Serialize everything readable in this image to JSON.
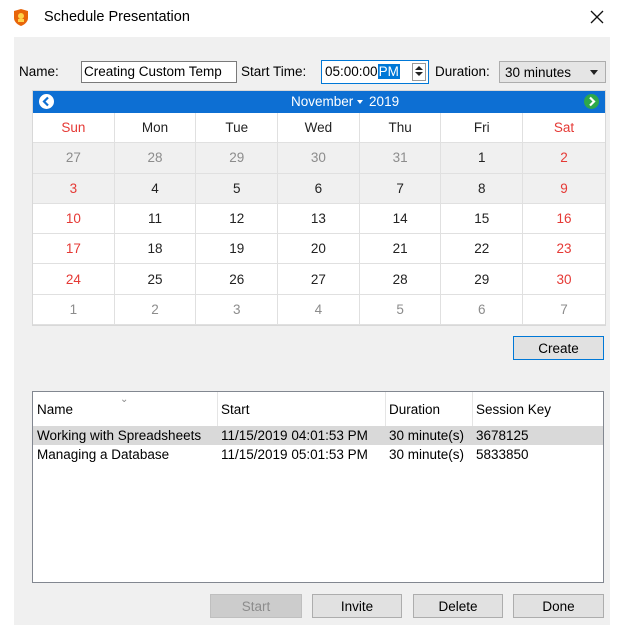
{
  "window": {
    "title": "Schedule Presentation",
    "app_icon": "presentation-app-icon",
    "close_icon": "close-icon"
  },
  "form": {
    "name_label": "Name:",
    "name_value": "Creating Custom Temp",
    "start_time_label": "Start Time:",
    "start_time_value": "05:00:00",
    "start_time_ampm": "PM",
    "duration_label": "Duration:",
    "duration_value": "30 minutes"
  },
  "calendar": {
    "month": "November",
    "year": "2019",
    "weekdays": [
      "Sun",
      "Mon",
      "Tue",
      "Wed",
      "Thu",
      "Fri",
      "Sat"
    ],
    "weeks": [
      [
        "27",
        "28",
        "29",
        "30",
        "31",
        "1",
        "2"
      ],
      [
        "3",
        "4",
        "5",
        "6",
        "7",
        "8",
        "9"
      ],
      [
        "10",
        "11",
        "12",
        "13",
        "14",
        "15",
        "16"
      ],
      [
        "17",
        "18",
        "19",
        "20",
        "21",
        "22",
        "23"
      ],
      [
        "24",
        "25",
        "26",
        "27",
        "28",
        "29",
        "30"
      ],
      [
        "1",
        "2",
        "3",
        "4",
        "5",
        "6",
        "7"
      ]
    ],
    "colors": {
      "header": "#0d6fd3",
      "weekend": "#e53935",
      "other_month": "#8c8c8c"
    }
  },
  "buttons": {
    "create": "Create",
    "start": "Start",
    "invite": "Invite",
    "delete": "Delete",
    "done": "Done"
  },
  "sessions": {
    "columns": [
      "Name",
      "Start",
      "Duration",
      "Session Key"
    ],
    "rows": [
      [
        "Working with Spreadsheets",
        "11/15/2019 04:01:53 PM",
        "30 minute(s)",
        "3678125"
      ],
      [
        "Managing a Database",
        "11/15/2019 05:01:53 PM",
        "30 minute(s)",
        "5833850"
      ]
    ],
    "selected_row": 0
  }
}
